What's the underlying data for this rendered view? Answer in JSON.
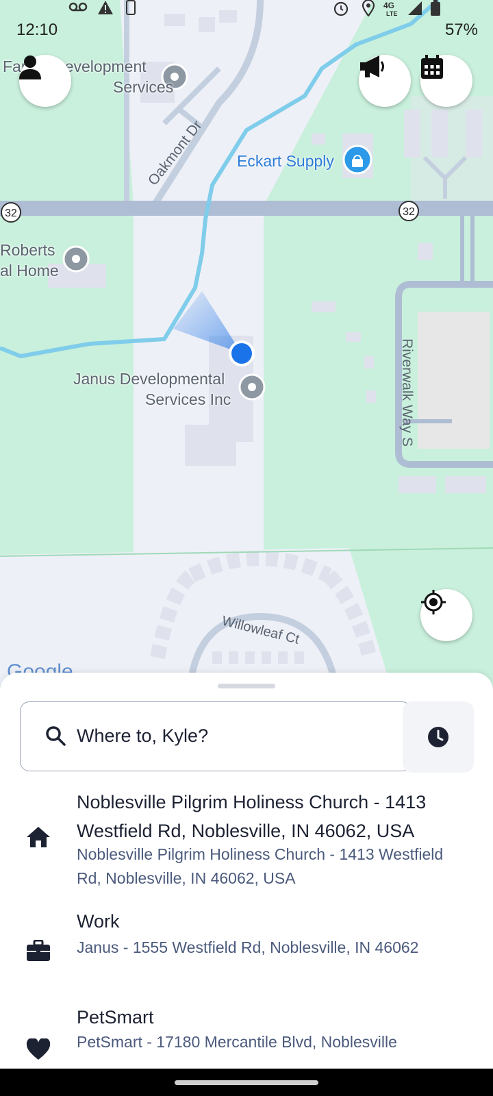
{
  "status_bar": {
    "time": "12:10",
    "battery": "57%",
    "network": "4G LTE"
  },
  "map": {
    "labels": {
      "family_dev_a": "Family Development",
      "family_dev_b": "Services",
      "oakmont": "Oakmont Dr",
      "eckart": "Eckart Supply",
      "roberts_a": "Roberts",
      "roberts_b": "al Home",
      "janus_a": "Janus Developmental",
      "janus_b": "Services Inc",
      "riverwalk": "Riverwalk Way S",
      "willowleaf": "Willowleaf Ct",
      "route_left": "32",
      "route_right": "32",
      "google": "Google"
    },
    "colors": {
      "land": "#c9f0dc",
      "road": "#aebdd3",
      "water": "#7fcdea",
      "location": "#1a73e8"
    }
  },
  "buttons": {
    "profile_icon": "person-icon",
    "announcements_icon": "megaphone-icon",
    "calendar_icon": "calendar-icon",
    "recenter_icon": "locate-icon",
    "history_icon": "clock-icon"
  },
  "search": {
    "placeholder": "Where to, Kyle?"
  },
  "saved_places": [
    {
      "icon": "home-icon",
      "title": "Noblesville Pilgrim Holiness Church - 1413 Westfield Rd, Noblesville, IN 46062, USA",
      "subtitle": "Noblesville Pilgrim Holiness Church - 1413 Westfield Rd, Noblesville, IN 46062, USA"
    },
    {
      "icon": "briefcase-icon",
      "title": "Work",
      "subtitle": "Janus - 1555 Westfield Rd, Noblesville, IN 46062"
    },
    {
      "icon": "heart-icon",
      "title": "PetSmart",
      "subtitle": "PetSmart - 17180 Mercantile Blvd, Noblesville"
    }
  ]
}
